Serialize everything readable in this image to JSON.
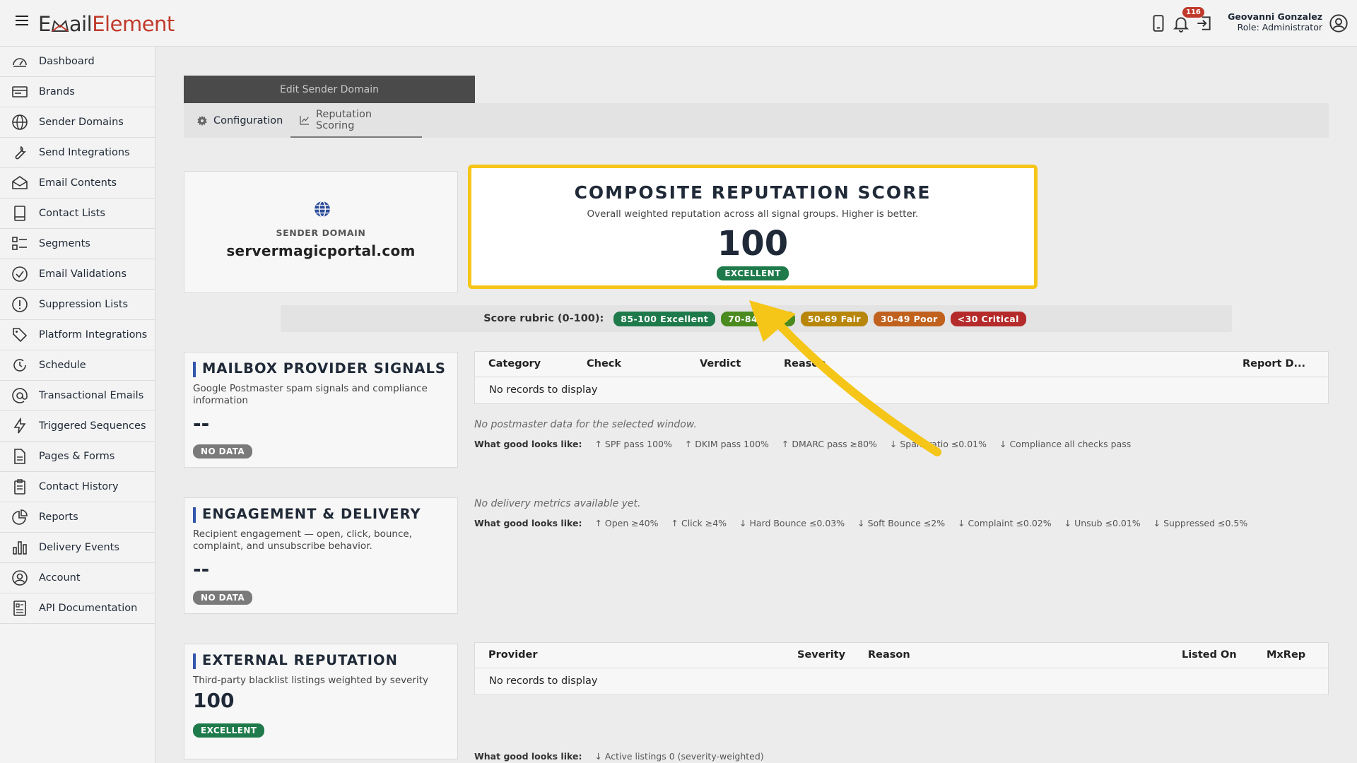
{
  "app": {
    "logo_prefix": "E",
    "logo_mid": "ail",
    "logo_suffix": "Element"
  },
  "header": {
    "notification_count": "116",
    "user_name": "Geovanni Gonzalez",
    "user_role": "Role: Administrator"
  },
  "sidebar": {
    "items": [
      {
        "label": "Dashboard",
        "icon": "dashboard-icon"
      },
      {
        "label": "Brands",
        "icon": "brands-icon"
      },
      {
        "label": "Sender Domains",
        "icon": "globe-icon"
      },
      {
        "label": "Send Integrations",
        "icon": "wrench-icon"
      },
      {
        "label": "Email Contents",
        "icon": "envelope-icon"
      },
      {
        "label": "Contact Lists",
        "icon": "book-icon"
      },
      {
        "label": "Segments",
        "icon": "segments-icon"
      },
      {
        "label": "Email Validations",
        "icon": "check-circle-icon"
      },
      {
        "label": "Suppression Lists",
        "icon": "exclamation-circle-icon"
      },
      {
        "label": "Platform Integrations",
        "icon": "tag-icon"
      },
      {
        "label": "Schedule",
        "icon": "clock-icon"
      },
      {
        "label": "Transactional Emails",
        "icon": "at-icon"
      },
      {
        "label": "Triggered Sequences",
        "icon": "lightning-icon"
      },
      {
        "label": "Pages & Forms",
        "icon": "file-icon"
      },
      {
        "label": "Contact History",
        "icon": "clipboard-icon"
      },
      {
        "label": "Reports",
        "icon": "pie-chart-icon"
      },
      {
        "label": "Delivery Events",
        "icon": "bar-chart-icon"
      },
      {
        "label": "Account",
        "icon": "user-circle-icon"
      },
      {
        "label": "API Documentation",
        "icon": "doc-icon"
      }
    ]
  },
  "page": {
    "header": "Edit Sender Domain",
    "tabs": [
      {
        "label": "Configuration",
        "icon": "gear-icon"
      },
      {
        "label": "Reputation Scoring",
        "icon": "line-chart-icon"
      }
    ]
  },
  "domain_card": {
    "label": "SENDER DOMAIN",
    "value": "servermagicportal.com"
  },
  "composite": {
    "title": "COMPOSITE REPUTATION SCORE",
    "subtitle": "Overall weighted reputation across all signal groups. Higher is better.",
    "score": "100",
    "status": "EXCELLENT"
  },
  "rubric": {
    "label": "Score rubric (0-100):",
    "items": [
      {
        "label": "85-100 Excellent",
        "color": "#1e7a4a"
      },
      {
        "label": "70-84 Good",
        "color": "#4a8a1e"
      },
      {
        "label": "50-69 Fair",
        "color": "#b8860b"
      },
      {
        "label": "30-49 Poor",
        "color": "#c0621e"
      },
      {
        "label": "<30 Critical",
        "color": "#b52a2a"
      }
    ]
  },
  "mailbox": {
    "title": "MAILBOX PROVIDER SIGNALS",
    "description": "Google Postmaster spam signals and compliance information",
    "value": "--",
    "status": "NO DATA",
    "table_columns": [
      "Category",
      "Check",
      "Verdict",
      "Reason",
      "Report D..."
    ],
    "empty": "No records to display",
    "note": "No postmaster data for the selected window.",
    "good_label": "What good looks like:",
    "good": [
      "↑ SPF pass 100%",
      "↑ DKIM pass 100%",
      "↑ DMARC pass ≥80%",
      "↓ Spam ratio ≤0.01%",
      "↓ Compliance all checks pass"
    ]
  },
  "engagement": {
    "title": "ENGAGEMENT & DELIVERY",
    "description": "Recipient engagement — open, click, bounce, complaint, and unsubscribe behavior.",
    "value": "--",
    "status": "NO DATA",
    "note": "No delivery metrics available yet.",
    "good_label": "What good looks like:",
    "good": [
      "↑ Open ≥40%",
      "↑ Click ≥4%",
      "↓ Hard Bounce ≤0.03%",
      "↓ Soft Bounce ≤2%",
      "↓ Complaint ≤0.02%",
      "↓ Unsub ≤0.01%",
      "↓ Suppressed ≤0.5%"
    ]
  },
  "external": {
    "title": "EXTERNAL REPUTATION",
    "description": "Third-party blacklist listings weighted by severity",
    "value": "100",
    "status": "EXCELLENT",
    "table_columns": [
      "Provider",
      "Severity",
      "Reason",
      "Listed On",
      "MxRep"
    ],
    "empty": "No records to display",
    "good_label": "What good looks like:",
    "good": [
      "↓ Active listings 0 (severity-weighted)"
    ]
  },
  "overlay": {
    "color": "#f5c518"
  }
}
